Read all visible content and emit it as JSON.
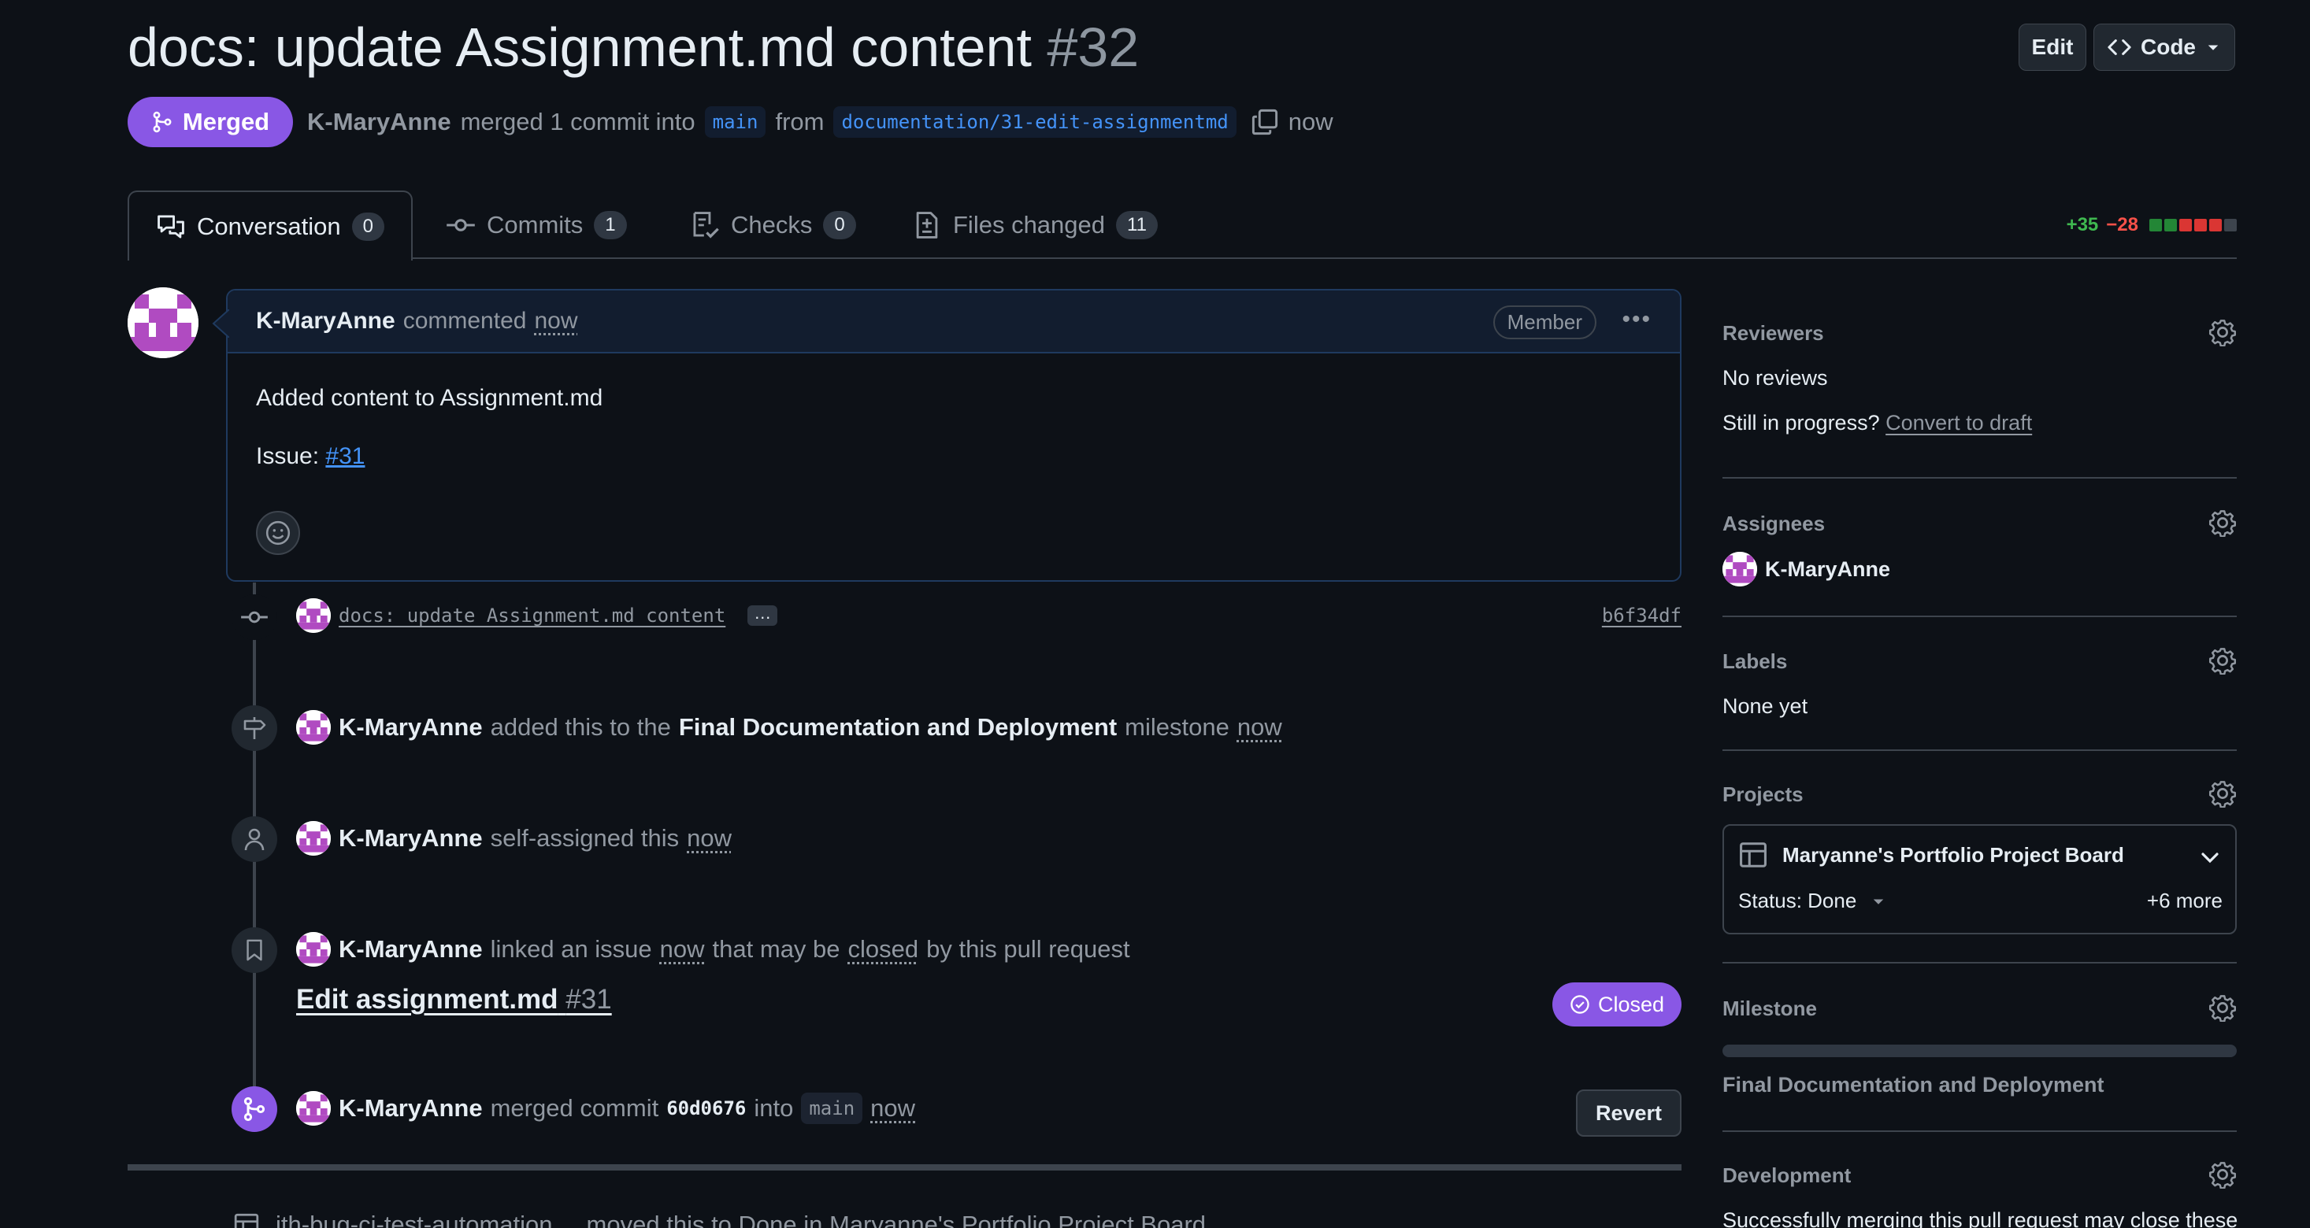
{
  "header": {
    "title": "docs: update Assignment.md content",
    "number": "#32",
    "edit_label": "Edit",
    "code_label": "Code",
    "state_label": "Merged",
    "author": "K-MaryAnne",
    "merge_text": "merged 1 commit into",
    "base_branch": "main",
    "from_text": "from",
    "head_branch": "documentation/31-edit-assignmentmd",
    "time": "now"
  },
  "tabs": [
    {
      "label": "Conversation",
      "count": "0"
    },
    {
      "label": "Commits",
      "count": "1"
    },
    {
      "label": "Checks",
      "count": "0"
    },
    {
      "label": "Files changed",
      "count": "11"
    }
  ],
  "diffstat": {
    "additions": "+35",
    "deletions": "−28",
    "colors": [
      "#238636",
      "#238636",
      "#da3633",
      "#da3633",
      "#da3633",
      "#3d444d"
    ]
  },
  "comment": {
    "author": "K-MaryAnne",
    "action": "commented",
    "time": "now",
    "role": "Member",
    "body": "Added content to Assignment.md",
    "issue_prefix": "Issue:",
    "issue_link": "#31"
  },
  "timeline": {
    "commit": {
      "message": "docs: update Assignment.md content",
      "ellipsis": "…",
      "sha": "b6f34df"
    },
    "milestone": {
      "author": "K-MaryAnne",
      "pre": "added this to the",
      "milestone": "Final Documentation and Deployment",
      "post": "milestone",
      "time": "now"
    },
    "assign": {
      "author": "K-MaryAnne",
      "text": "self-assigned this",
      "time": "now"
    },
    "link": {
      "author": "K-MaryAnne",
      "pre": "linked an issue",
      "time": "now",
      "mid": "that may be",
      "closed_word": "closed",
      "post": "by this pull request"
    },
    "issue": {
      "title": "Edit assignment.md",
      "number": "#31",
      "state": "Closed"
    },
    "merge": {
      "author": "K-MaryAnne",
      "pre": "merged commit",
      "sha": "60d0676",
      "into": "into",
      "branch": "main",
      "time": "now",
      "revert_label": "Revert"
    },
    "cut_text": "ith-bug-ci-test-automation ... moved this to Done in Maryanne's Portfolio Project Board"
  },
  "sidebar": {
    "reviewers": {
      "title": "Reviewers",
      "value": "No reviews",
      "draft_prompt": "Still in progress?",
      "draft_link": "Convert to draft"
    },
    "assignees": {
      "title": "Assignees",
      "value": "K-MaryAnne"
    },
    "labels": {
      "title": "Labels",
      "value": "None yet"
    },
    "projects": {
      "title": "Projects",
      "board": "Maryanne's Portfolio Project Board",
      "status": "Status: Done",
      "more": "+6 more"
    },
    "milestone": {
      "title": "Milestone",
      "value": "Final Documentation and Deployment",
      "progress": 0
    },
    "development": {
      "title": "Development",
      "text": "Successfully merging this pull request may close these"
    }
  }
}
